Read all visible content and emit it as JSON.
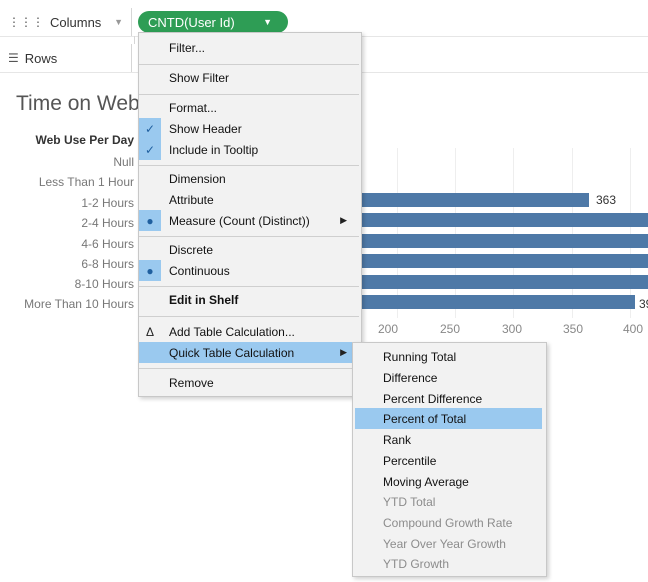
{
  "shelves": {
    "columns_label": "Columns",
    "rows_label": "Rows",
    "pill_label": "CNTD(User Id)"
  },
  "view": {
    "title": "Time on Web",
    "row_header": "Web Use Per Day",
    "categories": [
      "Null",
      "Less Than 1 Hour",
      "1-2 Hours",
      "2-4 Hours",
      "4-6 Hours",
      "6-8 Hours",
      "8-10 Hours",
      "More Than 10 Hours"
    ],
    "visible_bar_labels": [
      "363",
      "39"
    ],
    "axis_ticks": [
      "200",
      "250",
      "300",
      "350",
      "400"
    ]
  },
  "context_menu": {
    "items": [
      {
        "label": "Filter..."
      },
      {
        "label": "Show Filter"
      },
      {
        "label": "Format..."
      },
      {
        "label": "Show Header",
        "checked": true
      },
      {
        "label": "Include in Tooltip",
        "checked": true
      },
      {
        "label": "Dimension"
      },
      {
        "label": "Attribute"
      },
      {
        "label": "Measure (Count (Distinct))",
        "selected": true,
        "submenu": true
      },
      {
        "label": "Discrete"
      },
      {
        "label": "Continuous",
        "selected": true
      },
      {
        "label": "Edit in Shelf",
        "bold": true
      },
      {
        "label": "Add Table Calculation...",
        "icon": "delta"
      },
      {
        "label": "Quick Table Calculation",
        "submenu": true,
        "highlighted": true
      },
      {
        "label": "Remove"
      }
    ]
  },
  "quick_table_calc_submenu": {
    "items": [
      {
        "label": "Running Total",
        "enabled": true
      },
      {
        "label": "Difference",
        "enabled": true
      },
      {
        "label": "Percent Difference",
        "enabled": true
      },
      {
        "label": "Percent of Total",
        "enabled": true,
        "highlighted": true
      },
      {
        "label": "Rank",
        "enabled": true
      },
      {
        "label": "Percentile",
        "enabled": true
      },
      {
        "label": "Moving Average",
        "enabled": true
      },
      {
        "label": "YTD Total",
        "enabled": false
      },
      {
        "label": "Compound Growth Rate",
        "enabled": false
      },
      {
        "label": "Year Over Year Growth",
        "enabled": false
      },
      {
        "label": "YTD Growth",
        "enabled": false
      }
    ]
  },
  "colors": {
    "pill": "#2e9d55",
    "bar": "#4e79a7",
    "highlight": "#9ac9ef"
  }
}
